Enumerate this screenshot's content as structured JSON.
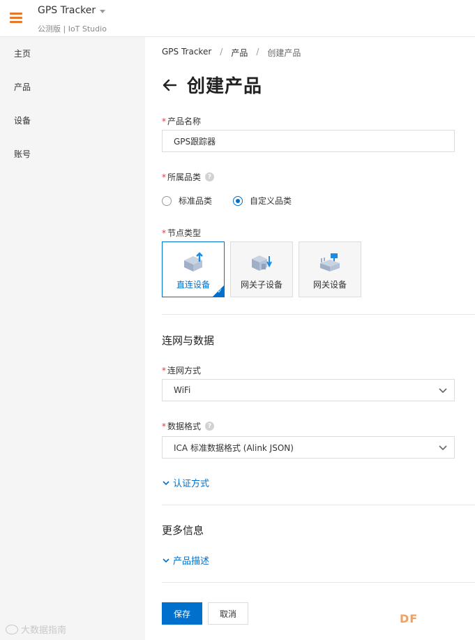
{
  "header": {
    "app_title": "GPS Tracker",
    "app_subtitle": "公测版 | IoT Studio"
  },
  "sidebar": {
    "items": [
      {
        "label": "主页"
      },
      {
        "label": "产品"
      },
      {
        "label": "设备"
      },
      {
        "label": "账号"
      }
    ],
    "watermark": "大数据指南"
  },
  "breadcrumb": {
    "items": [
      "GPS Tracker",
      "产品",
      "创建产品"
    ],
    "separator": "/"
  },
  "page": {
    "title": "创建产品"
  },
  "form": {
    "required_mark": "*",
    "product_name": {
      "label": "产品名称",
      "value": "GPS跟踪器"
    },
    "category": {
      "label": "所属品类",
      "help": "?",
      "options": [
        {
          "label": "标准品类",
          "checked": false
        },
        {
          "label": "自定义品类",
          "checked": true
        }
      ]
    },
    "node_type": {
      "label": "节点类型",
      "options": [
        {
          "label": "直连设备",
          "selected": true,
          "icon": "direct-device-icon"
        },
        {
          "label": "网关子设备",
          "selected": false,
          "icon": "gateway-subdevice-icon"
        },
        {
          "label": "网关设备",
          "selected": false,
          "icon": "gateway-device-icon"
        }
      ],
      "check_glyph": "✓"
    },
    "network_section": {
      "title": "连网与数据",
      "connection": {
        "label": "连网方式",
        "value": "WiFi"
      },
      "data_format": {
        "label": "数据格式",
        "help": "?",
        "value": "ICA 标准数据格式 (Alink JSON)"
      },
      "auth_link": "认证方式"
    },
    "more_section": {
      "title": "更多信息",
      "description_link": "产品描述"
    },
    "actions": {
      "save": "保存",
      "cancel": "取消"
    }
  },
  "corner_mark": "DF",
  "colors": {
    "accent": "#0070cc",
    "menu_orange": "#e8772a",
    "required_red": "#e23838",
    "sidebar_bg": "#f5f5f5"
  }
}
